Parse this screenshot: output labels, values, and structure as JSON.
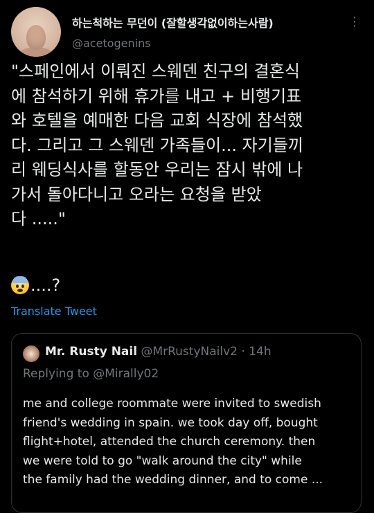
{
  "author": {
    "display_name": "하는척하는 무던이 (잘할생각없이하는사람)",
    "handle": "@acetogenins"
  },
  "tweet": {
    "lines": [
      "\"스페인에서 이뤄진 스웨덴 친구의 결혼식",
      "에 참석하기 위해  휴가를 내고 + 비행기표",
      "와 호텔을 예매한 다음  교회 식장에 참석했",
      "다. 그리고  그 스웨덴 가족들이... 자기들끼",
      "리 웨딩식사를 할동안  우리는 잠시 밖에 나",
      "가서 돌아다니고 오라는 요청을 받았",
      "다 .....\""
    ],
    "emoji_suffix": "....?",
    "translate_label": "Translate Tweet"
  },
  "quote": {
    "name": "Mr. Rusty Nail",
    "handle_time": "@MrRustyNailv2 · 14h",
    "replying_prefix": "Replying to",
    "replying_to": "@Mirally02",
    "lines": [
      "me and college roommate were invited to swedish",
      "friend's wedding in spain. we took day off, bought",
      "flight+hotel, attended the church ceremony. then",
      "we were told to go \"walk around the city\" while",
      "the family had the wedding dinner, and to come ..."
    ]
  },
  "icons": {
    "more": "more-options-icon",
    "emoji": "anxious-face-with-sweat-icon"
  },
  "colors": {
    "background": "#000000",
    "text": "#e7e9ea",
    "muted": "#71767b",
    "link": "#1d9bf0",
    "border": "#2f3336"
  }
}
